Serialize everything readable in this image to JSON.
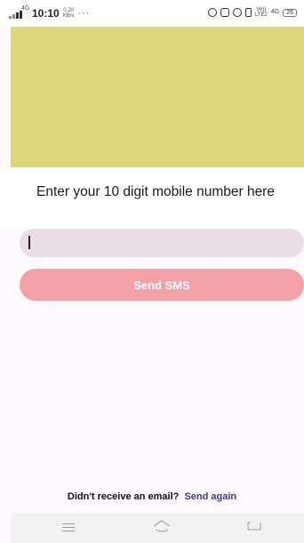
{
  "status_bar": {
    "network": "4G",
    "time": "10:10",
    "speed_value": "0.20",
    "speed_unit": "KB/s",
    "dots": "···",
    "volte_top": "Vo))",
    "volte_bottom": "LTE2",
    "network2": "4G",
    "battery": "26"
  },
  "banner": {
    "color": "#dcd77a"
  },
  "main": {
    "heading": "Enter your 10 digit mobile number here",
    "phone_input_value": "",
    "send_button_label": "Send SMS",
    "resend_question": "Didn't receive an email?",
    "resend_link": "Send again"
  },
  "colors": {
    "input_bg": "#e9dde6",
    "button_bg": "#f4a0a7",
    "link": "#3a3a8c"
  },
  "nav": {
    "icons": [
      "menu-icon",
      "home-icon",
      "back-icon"
    ]
  }
}
